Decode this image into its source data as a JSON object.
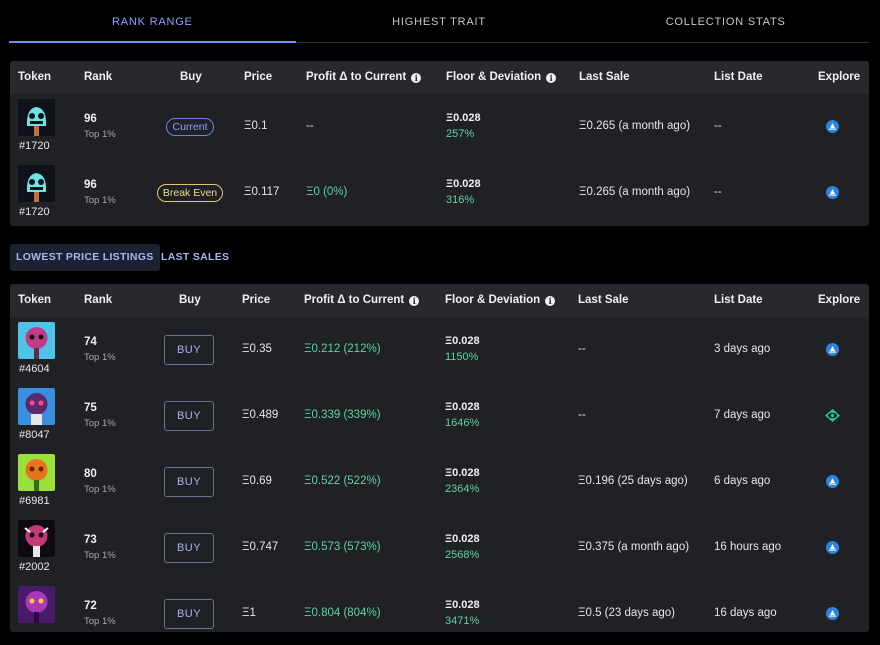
{
  "tabs": [
    {
      "label": "RANK RANGE"
    },
    {
      "label": "HIGHEST TRAIT"
    },
    {
      "label": "COLLECTION STATS"
    }
  ],
  "table_headers": {
    "token": "Token",
    "rank": "Rank",
    "buy": "Buy",
    "price": "Price",
    "profit": "Profit Δ to Current",
    "floor": "Floor & Deviation",
    "last_sale": "Last Sale",
    "list_date": "List Date",
    "explore": "Explore"
  },
  "info_icon": "i",
  "rank_range_rows": [
    {
      "token": "#1720",
      "rank": "96",
      "top": "Top 1%",
      "buy_tag": "Current",
      "price": "Ξ0.1",
      "profit": "--",
      "floor": "Ξ0.028",
      "deviation": "257%",
      "last_sale": "Ξ0.265 (a month ago)",
      "list_date": "--",
      "explore_icon": "opensea-icon"
    },
    {
      "token": "#1720",
      "rank": "96",
      "top": "Top 1%",
      "buy_tag": "Break Even",
      "price": "Ξ0.117",
      "profit": "Ξ0 (0%)",
      "floor": "Ξ0.028",
      "deviation": "316%",
      "last_sale": "Ξ0.265 (a month ago)",
      "list_date": "--",
      "explore_icon": "opensea-icon"
    }
  ],
  "subtabs": [
    {
      "label": "LOWEST PRICE LISTINGS"
    },
    {
      "label": "LAST SALES"
    }
  ],
  "listing_rows": [
    {
      "token": "#4604",
      "rank": "74",
      "top": "Top 1%",
      "buy": "BUY",
      "price": "Ξ0.35",
      "profit": "Ξ0.212 (212%)",
      "floor": "Ξ0.028",
      "deviation": "1150%",
      "last_sale": "--",
      "list_date": "3 days ago",
      "explore_icon": "opensea-icon"
    },
    {
      "token": "#8047",
      "rank": "75",
      "top": "Top 1%",
      "buy": "BUY",
      "price": "Ξ0.489",
      "profit": "Ξ0.339 (339%)",
      "floor": "Ξ0.028",
      "deviation": "1646%",
      "last_sale": "--",
      "list_date": "7 days ago",
      "explore_icon": "eye-icon"
    },
    {
      "token": "#6981",
      "rank": "80",
      "top": "Top 1%",
      "buy": "BUY",
      "price": "Ξ0.69",
      "profit": "Ξ0.522 (522%)",
      "floor": "Ξ0.028",
      "deviation": "2364%",
      "last_sale": "Ξ0.196 (25 days ago)",
      "list_date": "6 days ago",
      "explore_icon": "opensea-icon"
    },
    {
      "token": "#2002",
      "rank": "73",
      "top": "Top 1%",
      "buy": "BUY",
      "price": "Ξ0.747",
      "profit": "Ξ0.573 (573%)",
      "floor": "Ξ0.028",
      "deviation": "2568%",
      "last_sale": "Ξ0.375 (a month ago)",
      "list_date": "16 hours ago",
      "explore_icon": "opensea-icon"
    },
    {
      "token": "",
      "rank": "72",
      "top": "Top 1%",
      "buy": "BUY",
      "price": "Ξ1",
      "profit": "Ξ0.804 (804%)",
      "floor": "Ξ0.028",
      "deviation": "3471%",
      "last_sale": "Ξ0.5 (23 days ago)",
      "list_date": "16 days ago",
      "explore_icon": "opensea-icon"
    }
  ],
  "colors": {
    "accent": "#8ea2ff",
    "positive": "#5fd3a3",
    "break_even": "#f0dc8a",
    "panel": "#1f2125",
    "header": "#27292e"
  }
}
